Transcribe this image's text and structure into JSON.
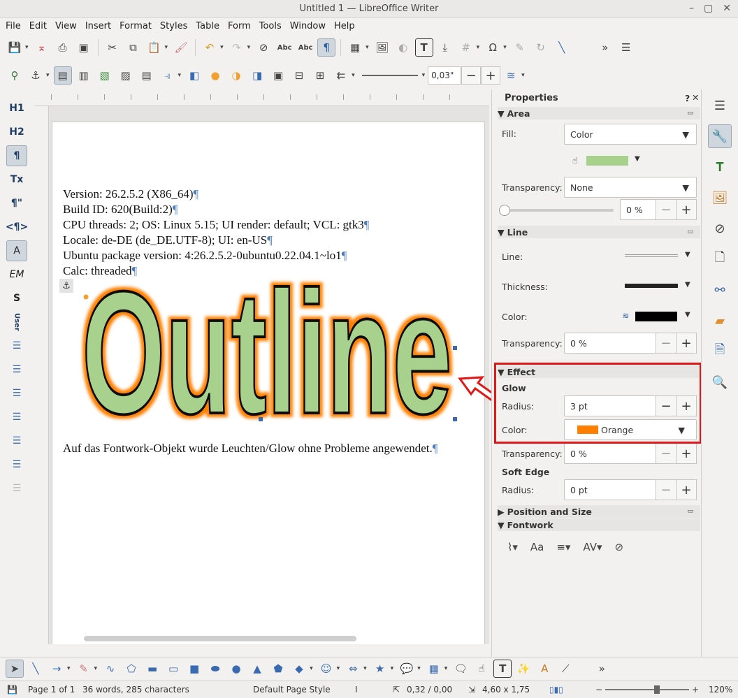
{
  "window": {
    "title": "Untitled 1 — LibreOffice Writer"
  },
  "menu": [
    "File",
    "Edit",
    "View",
    "Insert",
    "Format",
    "Styles",
    "Table",
    "Form",
    "Tools",
    "Window",
    "Help"
  ],
  "line_width_value": "0,03\"",
  "leftbar": [
    "H1",
    "H2",
    "¶",
    "Tx",
    "¶\"",
    "<¶>",
    "A",
    "EM",
    "S",
    "User"
  ],
  "document": {
    "lines": [
      "Version: 26.2.5.2 (X86_64)",
      "Build ID: 620(Build:2)",
      "CPU threads: 2; OS: Linux 5.15; UI render: default; VCL: gtk3",
      "Locale: de-DE (de_DE.UTF-8); UI: en-US",
      "Ubuntu package version: 4:26.2.5.2-0ubuntu0.22.04.1~lo1",
      "Calc: threaded"
    ],
    "fontwork_text": "Outline",
    "after_line": "Auf das Fontwork-Objekt wurde Leuchten/Glow ohne Probleme angewendet.",
    "pilcrow": "¶"
  },
  "sidebar": {
    "title": "Properties",
    "help": "?",
    "area": {
      "header": "Area",
      "fill_label": "Fill:",
      "fill_value": "Color",
      "fill_color": "#a9d18e",
      "transparency_label": "Transparency:",
      "transparency_value": "None",
      "slider_value": "0 %"
    },
    "line": {
      "header": "Line",
      "line_label": "Line:",
      "thickness_label": "Thickness:",
      "color_label": "Color:",
      "color": "#000000",
      "transparency_label": "Transparency:",
      "transparency_value": "0 %"
    },
    "effect": {
      "header": "Effect",
      "glow_label": "Glow",
      "radius_label": "Radius:",
      "radius_value": "3 pt",
      "color_label": "Color:",
      "color_value": "Orange",
      "color_swatch": "#ff8000",
      "transparency_label": "Transparency:",
      "transparency_value": "0 %",
      "soft_edge_label": "Soft Edge",
      "soft_radius_label": "Radius:",
      "soft_radius_value": "0 pt"
    },
    "position_header": "Position and Size",
    "fontwork_header": "Fontwork"
  },
  "statusbar": {
    "page": "Page 1 of 1",
    "words": "36 words, 285 characters",
    "style": "Default Page Style",
    "position": "0,32 / 0,00",
    "size": "4,60 x 1,75",
    "zoom": "120%"
  },
  "colors": {
    "accent": "#e01818",
    "glow": "#ff8000",
    "fill": "#a9d18e"
  }
}
